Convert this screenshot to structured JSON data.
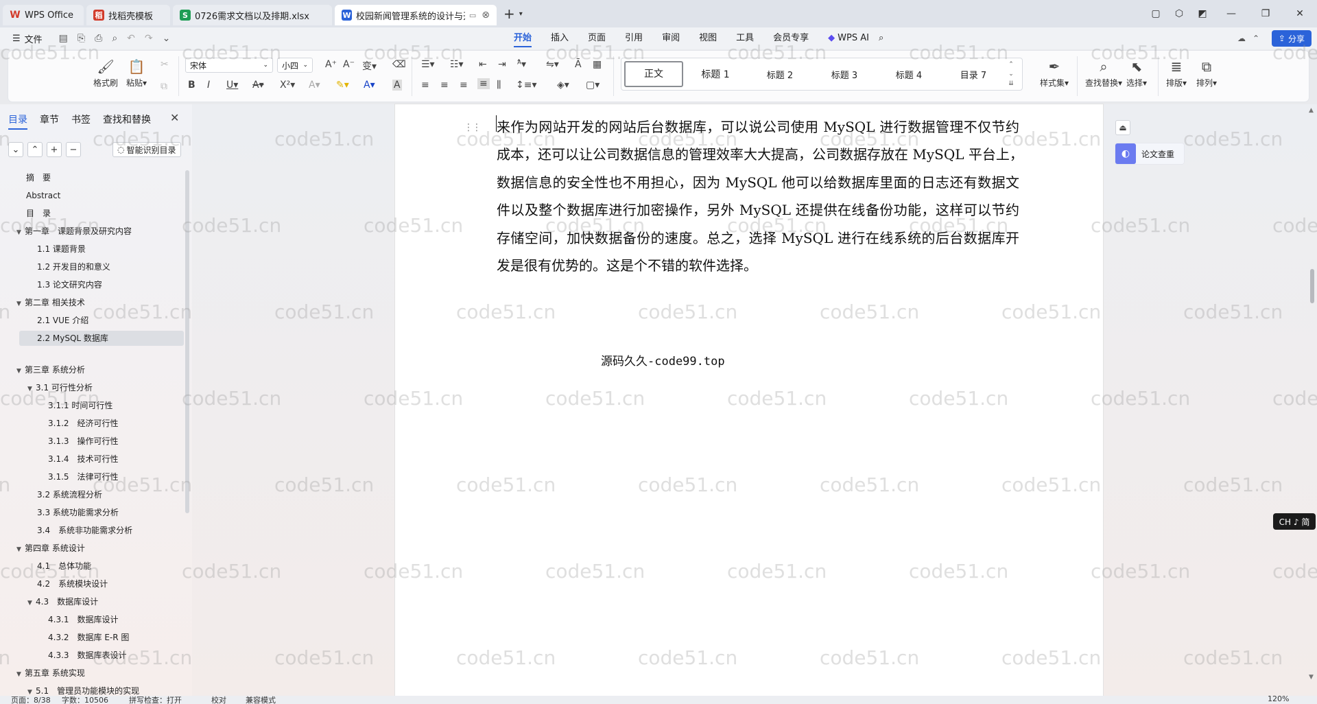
{
  "tabs": [
    {
      "label": "WPS Office",
      "icon": "wps-logo-icon",
      "color": "#d23b2b"
    },
    {
      "label": "找稻壳模板",
      "icon": "docer-icon",
      "color": "#d23b2b"
    },
    {
      "label": "0726需求文档以及排期.xlsx",
      "icon": "spreadsheet-icon",
      "color": "#1f9d55"
    },
    {
      "label": "校园新闻管理系统的设计与开",
      "icon": "word-doc-icon",
      "color": "#2b63d9"
    }
  ],
  "menu": {
    "file_label": "文件",
    "tabs": [
      "开始",
      "插入",
      "页面",
      "引用",
      "审阅",
      "视图",
      "工具",
      "会员专享"
    ],
    "active_tab": "开始",
    "wps_ai": "WPS AI",
    "share": "分享"
  },
  "ribbon": {
    "format_painter": "格式刷",
    "paste": "粘贴",
    "font_name": "宋体",
    "font_size": "小四",
    "styles": [
      "正文",
      "标题 1",
      "标题 2",
      "标题 3",
      "标题 4",
      "目录 7"
    ],
    "selected_style": "正文",
    "style_set": "样式集",
    "find_replace": "查找替换",
    "select": "选择",
    "layout": "排版",
    "arrange": "排列"
  },
  "nav": {
    "tabs": [
      "目录",
      "章节",
      "书签",
      "查找和替换"
    ],
    "active_tab": "目录",
    "smart_toc": "智能识别目录",
    "items": [
      {
        "label": "摘　要",
        "level": 0,
        "caret": false
      },
      {
        "label": "Abstract",
        "level": 0,
        "caret": false
      },
      {
        "label": "目　录",
        "level": 0,
        "caret": false
      },
      {
        "label": "第一章　课题背景及研究内容",
        "level": 0,
        "caret": true
      },
      {
        "label": "1.1 课题背景",
        "level": 1,
        "caret": false
      },
      {
        "label": "1.2 开发目的和意义",
        "level": 1,
        "caret": false
      },
      {
        "label": "1.3 论文研究内容",
        "level": 1,
        "caret": false
      },
      {
        "label": "第二章 相关技术",
        "level": 0,
        "caret": true
      },
      {
        "label": "2.1 VUE 介绍",
        "level": 1,
        "caret": false
      },
      {
        "label": "2.2 MySQL 数据库",
        "level": 1,
        "caret": false,
        "selected": true
      },
      {
        "label": "第三章 系统分析",
        "level": 0,
        "caret": true
      },
      {
        "label": "3.1 可行性分析",
        "level": 1,
        "caret": true
      },
      {
        "label": "3.1.1 时间可行性",
        "level": 2,
        "caret": false
      },
      {
        "label": "3.1.2　经济可行性",
        "level": 2,
        "caret": false
      },
      {
        "label": "3.1.3　操作可行性",
        "level": 2,
        "caret": false
      },
      {
        "label": "3.1.4　技术可行性",
        "level": 2,
        "caret": false
      },
      {
        "label": "3.1.5　法律可行性",
        "level": 2,
        "caret": false
      },
      {
        "label": "3.2 系统流程分析",
        "level": 1,
        "caret": false
      },
      {
        "label": "3.3 系统功能需求分析",
        "level": 1,
        "caret": false
      },
      {
        "label": "3.4　系统非功能需求分析",
        "level": 1,
        "caret": false
      },
      {
        "label": "第四章 系统设计",
        "level": 0,
        "caret": true
      },
      {
        "label": "4.1　总体功能",
        "level": 1,
        "caret": false
      },
      {
        "label": "4.2　系统模块设计",
        "level": 1,
        "caret": false
      },
      {
        "label": "4.3　数据库设计",
        "level": 1,
        "caret": true
      },
      {
        "label": "4.3.1　数据库设计",
        "level": 2,
        "caret": false
      },
      {
        "label": "4.3.2　数据库 E-R 图",
        "level": 2,
        "caret": false
      },
      {
        "label": "4.3.3　数据库表设计",
        "level": 2,
        "caret": false
      },
      {
        "label": "第五章 系统实现",
        "level": 0,
        "caret": true
      },
      {
        "label": "5.1　管理员功能模块的实现",
        "level": 1,
        "caret": true
      }
    ]
  },
  "document": {
    "lines": [
      "来作为网站开发的网站后台数据库，可以说公司使用 MySQL 进行数据管理不仅节约",
      "成本，还可以让公司数据信息的管理效率大大提高，公司数据存放在 MySQL 平台上，",
      "数据信息的安全性也不用担心，因为 MySQL 他可以给数据库里面的日志还有数据文",
      "件以及整个数据库进行加密操作，另外 MySQL 还提供在线备份功能，这样可以节约",
      "存储空间，加快数据备份的速度。总之，选择 MySQL 进行在线系统的后台数据库开",
      "发是很有优势的。这是个不错的软件选择。"
    ],
    "footer_text": "源码久久-code99.top"
  },
  "right_panel": {
    "paper_check": "论文查重",
    "ime": "CH ♪ 简"
  },
  "statusbar": {
    "page": "页面：8/38",
    "words": "字数：10506",
    "spell": "拼写检查：打开",
    "proof": "校对",
    "compat": "兼容模式",
    "zoom": "120%"
  },
  "watermark": "code51.cn"
}
